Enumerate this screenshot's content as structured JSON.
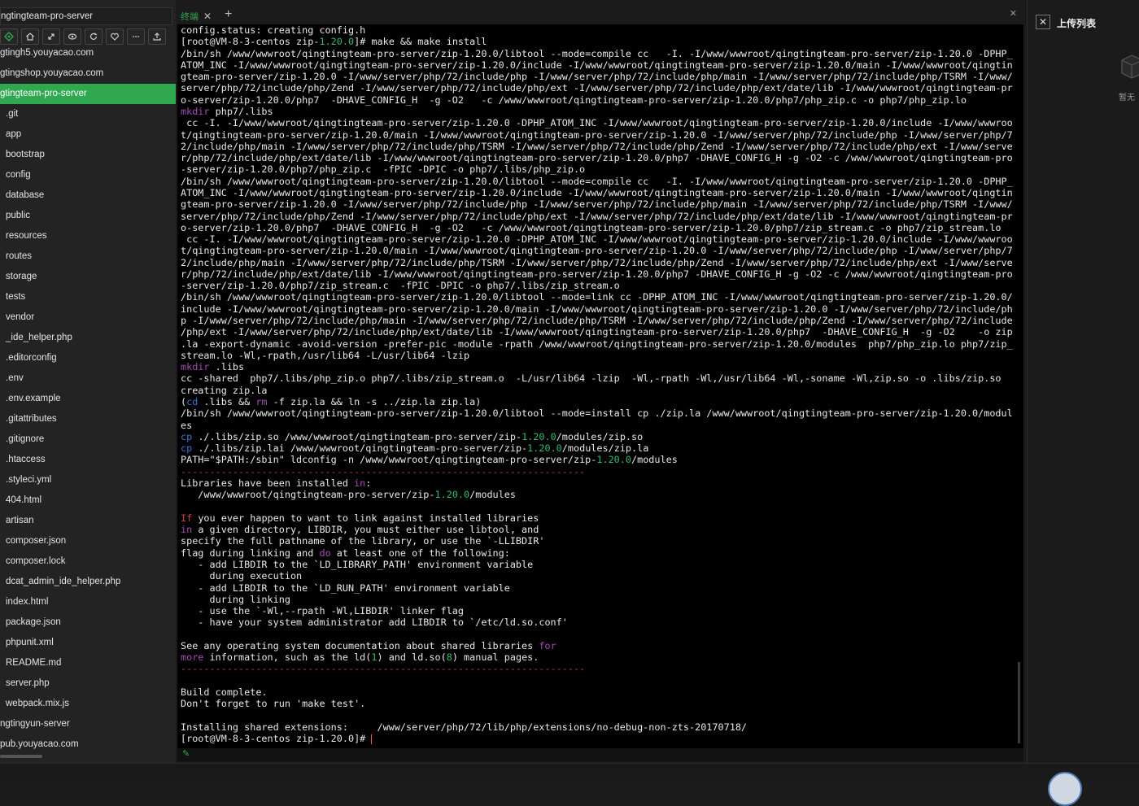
{
  "sidebar": {
    "project_title": "ngtingteam-pro-server",
    "toolbar_icons": [
      "git-icon",
      "home-icon",
      "expand-icon",
      "eye-icon",
      "refresh-icon",
      "heart-icon",
      "more-icon",
      "upload-icon"
    ],
    "items": [
      {
        "label": "gtingh5.youyacao.com",
        "level": "root",
        "active": false
      },
      {
        "label": "gtingshop.youyacao.com",
        "level": "root",
        "active": false
      },
      {
        "label": "gtingteam-pro-server",
        "level": "root",
        "active": true
      },
      {
        "label": ".git",
        "level": "child",
        "active": false
      },
      {
        "label": "app",
        "level": "child",
        "active": false
      },
      {
        "label": "bootstrap",
        "level": "child",
        "active": false
      },
      {
        "label": "config",
        "level": "child",
        "active": false
      },
      {
        "label": "database",
        "level": "child",
        "active": false
      },
      {
        "label": "public",
        "level": "child",
        "active": false
      },
      {
        "label": "resources",
        "level": "child",
        "active": false
      },
      {
        "label": "routes",
        "level": "child",
        "active": false
      },
      {
        "label": "storage",
        "level": "child",
        "active": false
      },
      {
        "label": "tests",
        "level": "child",
        "active": false
      },
      {
        "label": "vendor",
        "level": "child",
        "active": false
      },
      {
        "label": "_ide_helper.php",
        "level": "child",
        "active": false
      },
      {
        "label": ".editorconfig",
        "level": "child",
        "active": false
      },
      {
        "label": ".env",
        "level": "child",
        "active": false
      },
      {
        "label": ".env.example",
        "level": "child",
        "active": false
      },
      {
        "label": ".gitattributes",
        "level": "child",
        "active": false
      },
      {
        "label": ".gitignore",
        "level": "child",
        "active": false
      },
      {
        "label": ".htaccess",
        "level": "child",
        "active": false
      },
      {
        "label": ".styleci.yml",
        "level": "child",
        "active": false
      },
      {
        "label": "404.html",
        "level": "child",
        "active": false
      },
      {
        "label": "artisan",
        "level": "child",
        "active": false
      },
      {
        "label": "composer.json",
        "level": "child",
        "active": false
      },
      {
        "label": "composer.lock",
        "level": "child",
        "active": false
      },
      {
        "label": "dcat_admin_ide_helper.php",
        "level": "child",
        "active": false
      },
      {
        "label": "index.html",
        "level": "child",
        "active": false
      },
      {
        "label": "package.json",
        "level": "child",
        "active": false
      },
      {
        "label": "phpunit.xml",
        "level": "child",
        "active": false
      },
      {
        "label": "README.md",
        "level": "child",
        "active": false
      },
      {
        "label": "server.php",
        "level": "child",
        "active": false
      },
      {
        "label": "webpack.mix.js",
        "level": "child",
        "active": false
      },
      {
        "label": "ngtingyun-server",
        "level": "root",
        "active": false
      },
      {
        "label": "pub.youyacao.com",
        "level": "root",
        "active": false
      }
    ]
  },
  "terminal": {
    "tab_label": "终端",
    "accent": "#2fa84f",
    "lines": [
      [
        [
          "config.status: creating config.h",
          ""
        ]
      ],
      [
        [
          "[root@VM-8-3-centos zip-",
          ""
        ],
        [
          "1.20.0",
          "g"
        ],
        [
          "]# make && make install",
          ""
        ]
      ],
      [
        [
          "/bin/sh /www/wwwroot/qingtingteam-pro-server/zip-1.20.0/libtool --mode=compile cc   -I. -I/www/wwwroot/qingtingteam-pro-server/zip-1.20.0 -DPHP_",
          ""
        ]
      ],
      [
        [
          "ATOM_INC -I/www/wwwroot/qingtingteam-pro-server/zip-1.20.0/include -I/www/wwwroot/qingtingteam-pro-server/zip-1.20.0/main -I/www/wwwroot/qingtin",
          ""
        ]
      ],
      [
        [
          "gteam-pro-server/zip-1.20.0 -I/www/server/php/72/include/php -I/www/server/php/72/include/php/main -I/www/server/php/72/include/php/TSRM -I/www/",
          ""
        ]
      ],
      [
        [
          "server/php/72/include/php/Zend -I/www/server/php/72/include/php/ext -I/www/server/php/72/include/php/ext/date/lib -I/www/wwwroot/qingtingteam-pr",
          ""
        ]
      ],
      [
        [
          "o-server/zip-1.20.0/php7  -DHAVE_CONFIG_H  -g -O2   -c /www/wwwroot/qingtingteam-pro-server/zip-1.20.0/php7/php_zip.c -o php7/php_zip.lo",
          ""
        ]
      ],
      [
        [
          "mkdir",
          "m"
        ],
        [
          " php7/.libs",
          ""
        ]
      ],
      [
        [
          " cc -I. -I/www/wwwroot/qingtingteam-pro-server/zip-1.20.0 -DPHP_ATOM_INC -I/www/wwwroot/qingtingteam-pro-server/zip-1.20.0/include -I/www/wwwroo",
          ""
        ]
      ],
      [
        [
          "t/qingtingteam-pro-server/zip-1.20.0/main -I/www/wwwroot/qingtingteam-pro-server/zip-1.20.0 -I/www/server/php/72/include/php -I/www/server/php/7",
          ""
        ]
      ],
      [
        [
          "2/include/php/main -I/www/server/php/72/include/php/TSRM -I/www/server/php/72/include/php/Zend -I/www/server/php/72/include/php/ext -I/www/serve",
          ""
        ]
      ],
      [
        [
          "r/php/72/include/php/ext/date/lib -I/www/wwwroot/qingtingteam-pro-server/zip-1.20.0/php7 -DHAVE_CONFIG_H -g -O2 -c /www/wwwroot/qingtingteam-pro",
          ""
        ]
      ],
      [
        [
          "-server/zip-1.20.0/php7/php_zip.c  -fPIC -DPIC -o php7/.libs/php_zip.o",
          ""
        ]
      ],
      [
        [
          "/bin/sh /www/wwwroot/qingtingteam-pro-server/zip-1.20.0/libtool --mode=compile cc   -I. -I/www/wwwroot/qingtingteam-pro-server/zip-1.20.0 -DPHP_",
          ""
        ]
      ],
      [
        [
          "ATOM_INC -I/www/wwwroot/qingtingteam-pro-server/zip-1.20.0/include -I/www/wwwroot/qingtingteam-pro-server/zip-1.20.0/main -I/www/wwwroot/qingtin",
          ""
        ]
      ],
      [
        [
          "gteam-pro-server/zip-1.20.0 -I/www/server/php/72/include/php -I/www/server/php/72/include/php/main -I/www/server/php/72/include/php/TSRM -I/www/",
          ""
        ]
      ],
      [
        [
          "server/php/72/include/php/Zend -I/www/server/php/72/include/php/ext -I/www/server/php/72/include/php/ext/date/lib -I/www/wwwroot/qingtingteam-pr",
          ""
        ]
      ],
      [
        [
          "o-server/zip-1.20.0/php7  -DHAVE_CONFIG_H  -g -O2   -c /www/wwwroot/qingtingteam-pro-server/zip-1.20.0/php7/zip_stream.c -o php7/zip_stream.lo",
          ""
        ]
      ],
      [
        [
          " cc -I. -I/www/wwwroot/qingtingteam-pro-server/zip-1.20.0 -DPHP_ATOM_INC -I/www/wwwroot/qingtingteam-pro-server/zip-1.20.0/include -I/www/wwwroo",
          ""
        ]
      ],
      [
        [
          "t/qingtingteam-pro-server/zip-1.20.0/main -I/www/wwwroot/qingtingteam-pro-server/zip-1.20.0 -I/www/server/php/72/include/php -I/www/server/php/7",
          ""
        ]
      ],
      [
        [
          "2/include/php/main -I/www/server/php/72/include/php/TSRM -I/www/server/php/72/include/php/Zend -I/www/server/php/72/include/php/ext -I/www/serve",
          ""
        ]
      ],
      [
        [
          "r/php/72/include/php/ext/date/lib -I/www/wwwroot/qingtingteam-pro-server/zip-1.20.0/php7 -DHAVE_CONFIG_H -g -O2 -c /www/wwwroot/qingtingteam-pro",
          ""
        ]
      ],
      [
        [
          "-server/zip-1.20.0/php7/zip_stream.c  -fPIC -DPIC -o php7/.libs/zip_stream.o",
          ""
        ]
      ],
      [
        [
          "/bin/sh /www/wwwroot/qingtingteam-pro-server/zip-1.20.0/libtool --mode=link cc -DPHP_ATOM_INC -I/www/wwwroot/qingtingteam-pro-server/zip-1.20.0/",
          ""
        ]
      ],
      [
        [
          "include -I/www/wwwroot/qingtingteam-pro-server/zip-1.20.0/main -I/www/wwwroot/qingtingteam-pro-server/zip-1.20.0 -I/www/server/php/72/include/ph",
          ""
        ]
      ],
      [
        [
          "p -I/www/server/php/72/include/php/main -I/www/server/php/72/include/php/TSRM -I/www/server/php/72/include/php/Zend -I/www/server/php/72/include",
          ""
        ]
      ],
      [
        [
          "/php/ext -I/www/server/php/72/include/php/ext/date/lib -I/www/wwwroot/qingtingteam-pro-server/zip-1.20.0/php7  -DHAVE_CONFIG_H  -g -O2    -o zip",
          ""
        ]
      ],
      [
        [
          ".la -export-dynamic -avoid-version -prefer-pic -module -rpath /www/wwwroot/qingtingteam-pro-server/zip-1.20.0/modules  php7/php_zip.lo php7/zip_",
          ""
        ]
      ],
      [
        [
          "stream.lo -Wl,-rpath,/usr/lib64 -L/usr/lib64 -lzip",
          ""
        ]
      ],
      [
        [
          "mkdir",
          "m"
        ],
        [
          " .libs",
          ""
        ]
      ],
      [
        [
          "cc -shared  php7/.libs/php_zip.o php7/.libs/zip_stream.o  -L/usr/lib64 -lzip  -Wl,-rpath -Wl,/usr/lib64 -Wl,-soname -Wl,zip.so -o .libs/zip.so",
          ""
        ]
      ],
      [
        [
          "creating zip.la",
          ""
        ]
      ],
      [
        [
          "(",
          ""
        ],
        [
          "cd",
          "b"
        ],
        [
          " .libs && ",
          ""
        ],
        [
          "rm",
          "m"
        ],
        [
          " -f zip.la && ln -s ../zip.la zip.la)",
          ""
        ]
      ],
      [
        [
          "/bin/sh /www/wwwroot/qingtingteam-pro-server/zip-1.20.0/libtool --mode=install cp ./zip.la /www/wwwroot/qingtingteam-pro-server/zip-1.20.0/modul",
          ""
        ]
      ],
      [
        [
          "es",
          ""
        ]
      ],
      [
        [
          "cp",
          "b"
        ],
        [
          " ./.libs/zip.so /www/wwwroot/qingtingteam-pro-server/zip-",
          ""
        ],
        [
          "1.20.0",
          "g"
        ],
        [
          "/modules/zip.so",
          ""
        ]
      ],
      [
        [
          "cp",
          "b"
        ],
        [
          " ./.libs/zip.lai /www/wwwroot/qingtingteam-pro-server/zip-",
          ""
        ],
        [
          "1.20.0",
          "g"
        ],
        [
          "/modules/zip.la",
          ""
        ]
      ],
      [
        [
          "PATH=\"$PATH:/sbin\" ldconfig -n /www/wwwroot/qingtingteam-pro-server/zip-",
          ""
        ],
        [
          "1.20.0",
          "g"
        ],
        [
          "/modules",
          ""
        ]
      ],
      [
        [
          "----------------------------------------------------------------------",
          "dash"
        ]
      ],
      [
        [
          "Libraries have been installed ",
          ""
        ],
        [
          "in",
          "m"
        ],
        [
          ":",
          ""
        ]
      ],
      [
        [
          "   /www/wwwroot/qingtingteam-pro-server/zip-",
          ""
        ],
        [
          "1.20.0",
          "g"
        ],
        [
          "/modules",
          ""
        ]
      ],
      [
        [
          "",
          ""
        ]
      ],
      [
        [
          "If",
          "r"
        ],
        [
          " you ever happen to want to link against installed libraries",
          ""
        ]
      ],
      [
        [
          "in",
          "m"
        ],
        [
          " a given directory, LIBDIR, you must either use libtool, and",
          ""
        ]
      ],
      [
        [
          "specify the full pathname of the library, or use the `-LLIBDIR'",
          ""
        ]
      ],
      [
        [
          "flag during linking and ",
          ""
        ],
        [
          "do",
          "m"
        ],
        [
          " at least one of the following:",
          ""
        ]
      ],
      [
        [
          "   - add LIBDIR to the `LD_LIBRARY_PATH' environment variable",
          ""
        ]
      ],
      [
        [
          "     during execution",
          ""
        ]
      ],
      [
        [
          "   - add LIBDIR to the `LD_RUN_PATH' environment variable",
          ""
        ]
      ],
      [
        [
          "     during linking",
          ""
        ]
      ],
      [
        [
          "   - use the `-Wl,--rpath -Wl,LIBDIR' linker flag",
          ""
        ]
      ],
      [
        [
          "   - have your system administrator add LIBDIR to `/etc/ld.so.conf'",
          ""
        ]
      ],
      [
        [
          "",
          ""
        ]
      ],
      [
        [
          "See any operating system documentation about shared libraries ",
          ""
        ],
        [
          "for",
          "m"
        ]
      ],
      [
        [
          "more",
          "m"
        ],
        [
          " information, such as the ld(",
          ""
        ],
        [
          "1",
          "g"
        ],
        [
          ") and ld.so(",
          ""
        ],
        [
          "8",
          "g"
        ],
        [
          ") manual pages.",
          ""
        ]
      ],
      [
        [
          "----------------------------------------------------------------------",
          "dash"
        ]
      ],
      [
        [
          "",
          ""
        ]
      ],
      [
        [
          "Build complete.",
          ""
        ]
      ],
      [
        [
          "Don't forget to run 'make test'.",
          ""
        ]
      ],
      [
        [
          "",
          ""
        ]
      ],
      [
        [
          "Installing shared extensions:     /www/server/php/72/lib/php/extensions/no-debug-non-zts-20170718/",
          ""
        ]
      ],
      [
        [
          "[root@VM-8-3-centos zip-1.20.0]# ",
          ""
        ]
      ]
    ]
  },
  "upload_panel": {
    "title": "上传列表",
    "empty_text": "暂无"
  }
}
